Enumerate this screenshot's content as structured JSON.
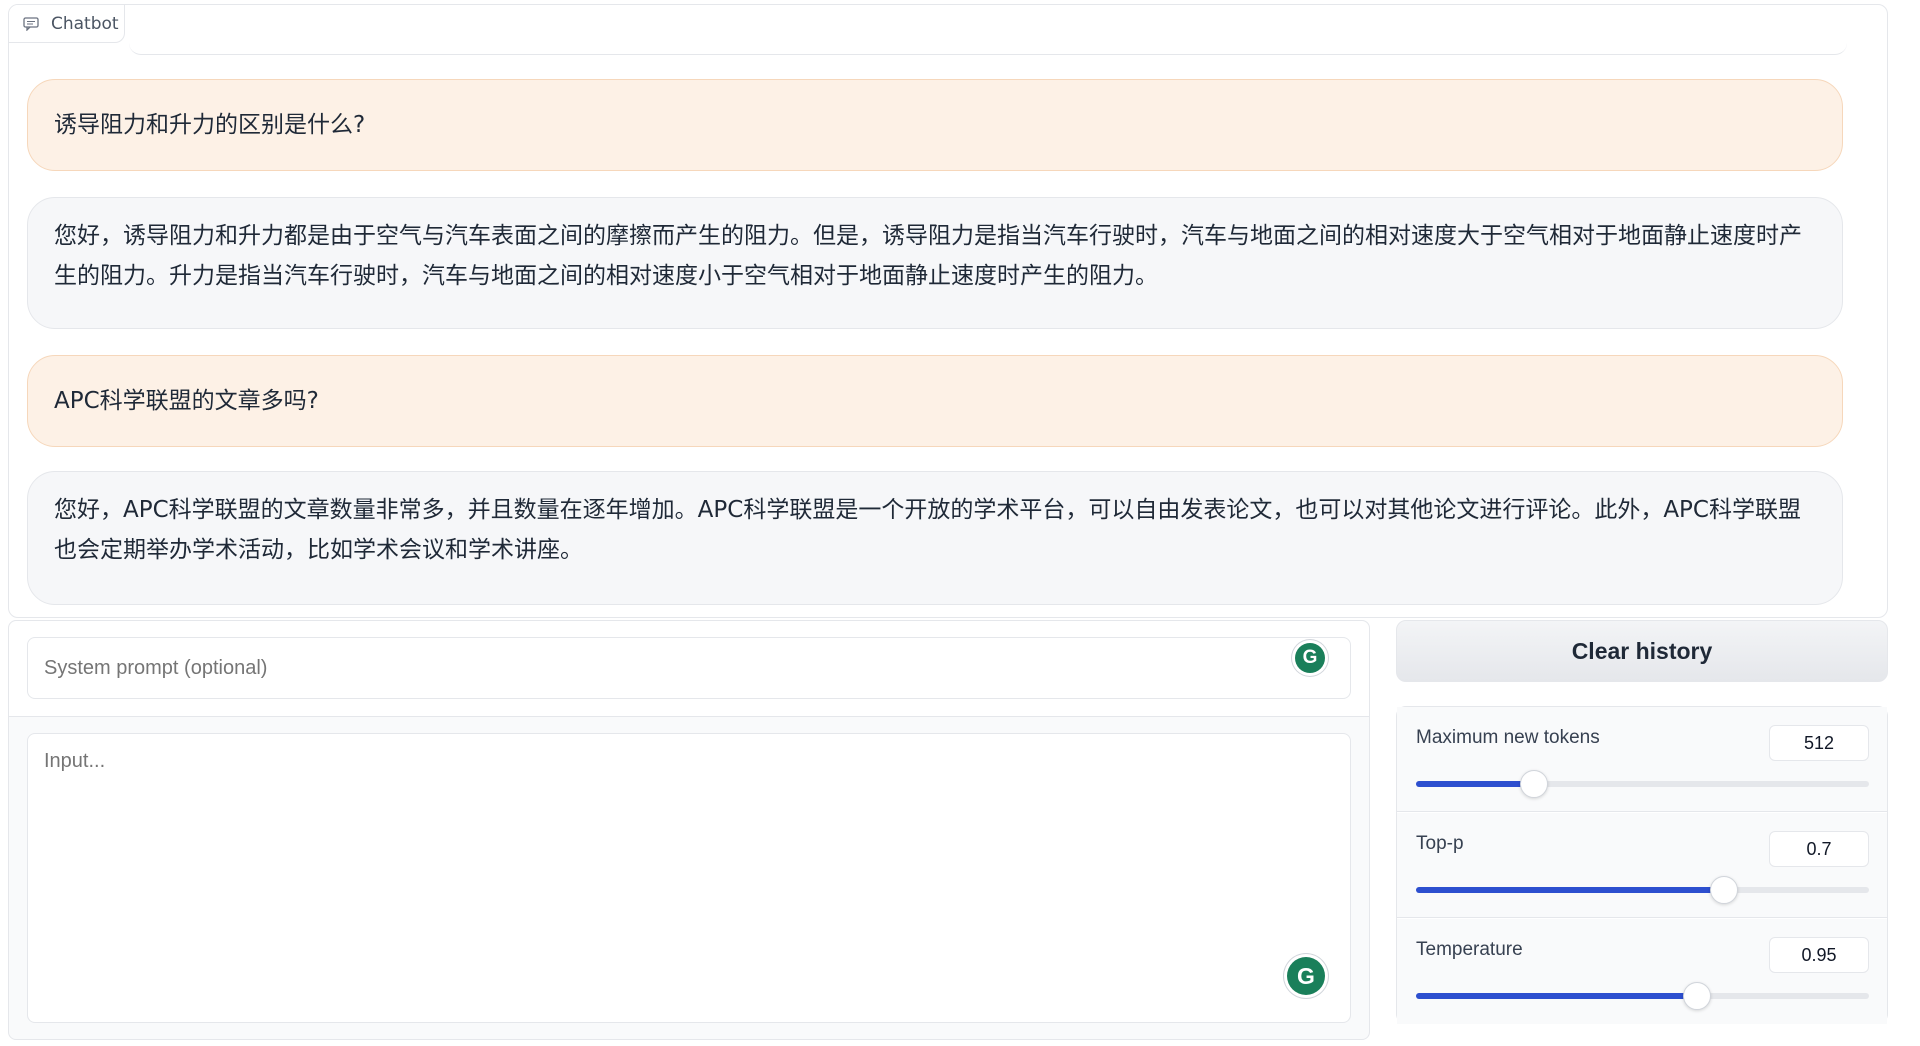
{
  "chatbot": {
    "label": "Chatbot",
    "messages": [
      {
        "role": "user",
        "text": "诱导阻力和升力的区别是什么?"
      },
      {
        "role": "bot",
        "text": "您好，诱导阻力和升力都是由于空气与汽车表面之间的摩擦而产生的阻力。但是，诱导阻力是指当汽车行驶时，汽车与地面之间的相对速度大于空气相对于地面静止速度时产生的阻力。升力是指当汽车行驶时，汽车与地面之间的相对速度小于空气相对于地面静止速度时产生的阻力。"
      },
      {
        "role": "user",
        "text": "APC科学联盟的文章多吗?"
      },
      {
        "role": "bot",
        "text": "您好，APC科学联盟的文章数量非常多，并且数量在逐年增加。APC科学联盟是一个开放的学术平台，可以自由发表论文，也可以对其他论文进行评论。此外，APC科学联盟也会定期举办学术活动，比如学术会议和学术讲座。"
      }
    ]
  },
  "inputs": {
    "system_prompt_placeholder": "System prompt (optional)",
    "input_placeholder": "Input...",
    "grammar_icon_glyph": "G"
  },
  "controls": {
    "clear_label": "Clear history",
    "sliders": [
      {
        "label": "Maximum new tokens",
        "value": "512",
        "fraction": 0.26
      },
      {
        "label": "Top-p",
        "value": "0.7",
        "fraction": 0.68
      },
      {
        "label": "Temperature",
        "value": "0.95",
        "fraction": 0.62
      }
    ]
  },
  "colors": {
    "user_bubble": "#fdf1e6",
    "bot_bubble": "#f6f7f9",
    "slider_fill": "#2d4fcf",
    "grammar_icon": "#1a7f5a"
  }
}
